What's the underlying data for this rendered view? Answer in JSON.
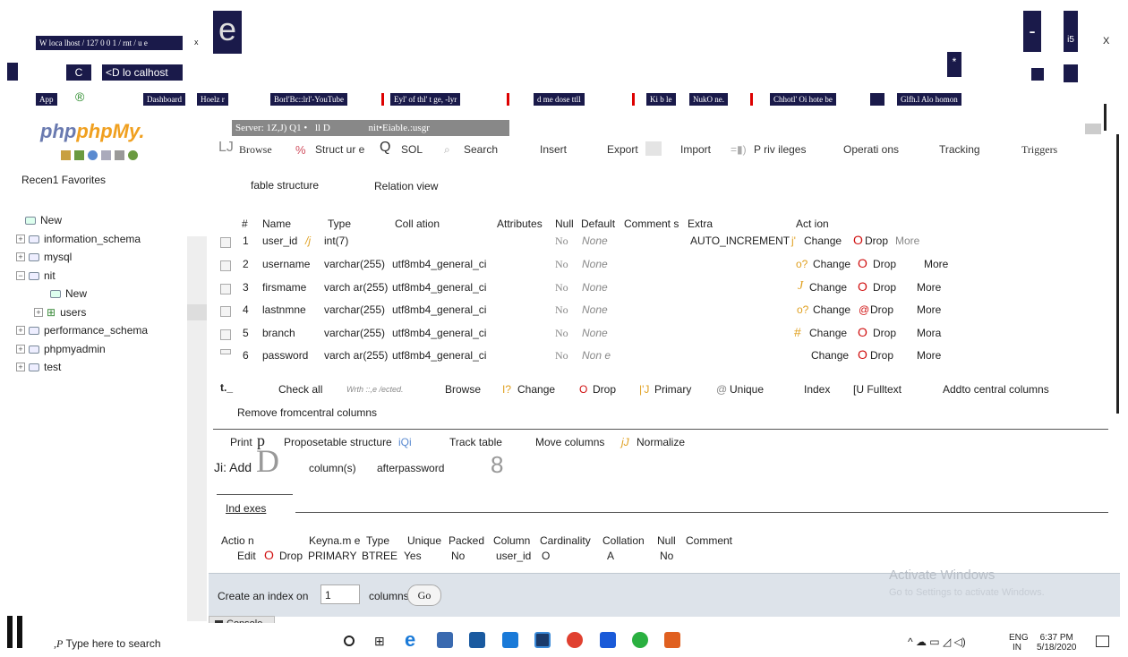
{
  "browser": {
    "tab_title": "W  loca lhost / 127 0 0 1 / rnt / u e",
    "tab_close": "x",
    "logo_char": "e",
    "window_min": "-",
    "window_max": "i5",
    "window_close": "X",
    "back": "C",
    "address": "<D lo calhost",
    "star": "*"
  },
  "bookmarks": [
    "App",
    "Dashboard",
    "Hoelz r",
    "Borl'Bc::lrl'-YouTube",
    "Eyl' of thl' t ge, -lyr",
    "d me dose ttll",
    "Ki b le",
    "NukO ne.",
    "Chhotl' Oi hote be",
    "Glfh.l Alo homon"
  ],
  "pma": {
    "logo": "phpMy.",
    "recent_favorites": "Recen1 Favorites",
    "tree": [
      {
        "label": "New",
        "icon": "new"
      },
      {
        "label": "information_schema",
        "icon": "db"
      },
      {
        "label": "mysql",
        "icon": "db"
      },
      {
        "label": "nit",
        "icon": "db"
      },
      {
        "label": "New",
        "icon": "new"
      },
      {
        "label": "users",
        "icon": "table"
      },
      {
        "label": "performance_schema",
        "icon": "db"
      },
      {
        "label": "phpmyadmin",
        "icon": "db"
      },
      {
        "label": "test",
        "icon": "db"
      }
    ],
    "breadcrumb": {
      "server": "Server: 1Z,J) Q1 •",
      "db": "ll D",
      "table": "nit•Eiable.:usgr"
    },
    "tabs": [
      "Browse",
      "Struct ur e",
      "SOL",
      "Search",
      "Insert",
      "Export",
      "Import",
      "P riv ileges",
      "Operati ons",
      "Tracking",
      "Triggers"
    ],
    "subtabs": [
      "fable structure",
      "Relation view"
    ],
    "columns_header": [
      "#",
      "Name",
      "Type",
      "Coll ation",
      "Attributes",
      "Null",
      "Default",
      "Comment s",
      "Extra",
      "Act ion"
    ],
    "rows": [
      {
        "num": "1",
        "name": "user_id",
        "key": "/j",
        "type": "int(7)",
        "collation": "",
        "null": "No",
        "default": "None",
        "extra": "AUTO_INCREMENT",
        "change": "Change",
        "drop": "Drop",
        "more": "More"
      },
      {
        "num": "2",
        "name": "username",
        "key": "",
        "type": "varchar(255)",
        "collation": "utf8mb4_general_ci",
        "null": "No",
        "default": "None",
        "extra": "",
        "change": "Change",
        "drop": "Drop",
        "more": "More"
      },
      {
        "num": "3",
        "name": "firsmame",
        "key": "",
        "type": "varch ar(255)",
        "collation": "utf8mb4_general_ci",
        "null": "No",
        "default": "None",
        "extra": "",
        "change": "Change",
        "drop": "Drop",
        "more": "More"
      },
      {
        "num": "4",
        "name": "lastnmne",
        "key": "",
        "type": "varchar(255)",
        "collation": "utf8mb4_general_ci",
        "null": "No",
        "default": "None",
        "extra": "",
        "change": "Change",
        "drop": "Drop",
        "more": "More"
      },
      {
        "num": "5",
        "name": "branch",
        "key": "",
        "type": "varchar(255)",
        "collation": "utf8mb4_general_ci",
        "null": "No",
        "default": "None",
        "extra": "",
        "change": "Change",
        "drop": "Drop",
        "more": "Mora"
      },
      {
        "num": "6",
        "name": "password",
        "key": "",
        "type": "varch ar(255)",
        "collation": "utf8mb4_general_ci",
        "null": "No",
        "default": "Non e",
        "extra": "",
        "change": "Change",
        "drop": "Drop",
        "more": "More"
      }
    ],
    "with_selected": {
      "check_all": "Check all",
      "with_selected": "Wrth ::,e /ected.",
      "browse": "Browse",
      "change": "Change",
      "drop": "Drop",
      "primary": "Primary",
      "unique": "Unique",
      "index": "Index",
      "fulltext": "[U Fulltext",
      "add_central": "Addto central columns",
      "remove_central": "Remove fromcentral columns"
    },
    "toolbar": {
      "print": "Print",
      "propose": "Proposetable structure",
      "track": "Track table",
      "move": "Move columns",
      "normalize": "Normalize"
    },
    "add": {
      "label": "Ji: Add",
      "value": "D",
      "columns": "column(s)",
      "after": "afterpassword",
      "num": "8"
    },
    "indexes": {
      "title": "Ind exes",
      "headers": [
        "Actio n",
        "Keyna.m e",
        "Type",
        "Unique",
        "Packed",
        "Column",
        "Cardinality",
        "Collation",
        "Null",
        "Comment"
      ],
      "row": {
        "edit": "Edit",
        "drop": "Drop",
        "keyname": "PRIMARY",
        "type": "BTREE",
        "unique": "Yes",
        "packed": "No",
        "column": "user_id",
        "cardinality": "O",
        "collation": "A",
        "null": "No"
      }
    },
    "create_index": {
      "label": "Create an index on",
      "value": "1",
      "columns": "columns",
      "go": "Go"
    },
    "console": "Console"
  },
  "watermark": {
    "line1": "Activate Windows",
    "line2": "Go to Settings to activate Windows."
  },
  "taskbar": {
    "search": "Type here to search",
    "search_icon": ",P",
    "lang": "ENG",
    "region": "IN",
    "time": "6:37 PM",
    "date": "5/18/2020"
  }
}
